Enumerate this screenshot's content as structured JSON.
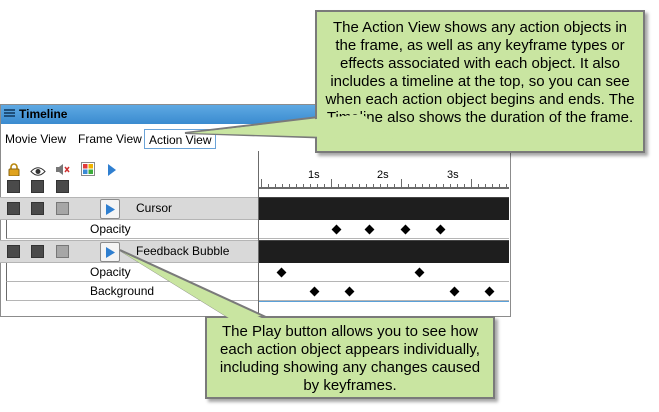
{
  "window": {
    "title": "Timeline",
    "tabs": [
      {
        "label": "Movie View",
        "active": false
      },
      {
        "label": "Frame View",
        "active": false
      },
      {
        "label": "Action View",
        "active": true
      }
    ]
  },
  "ruler": {
    "labels": [
      "1s",
      "2s",
      "3s"
    ]
  },
  "rows": [
    {
      "type": "object",
      "label": "Cursor"
    },
    {
      "type": "prop",
      "label": "Opacity"
    },
    {
      "type": "object",
      "label": "Feedback Bubble"
    },
    {
      "type": "prop",
      "label": "Opacity"
    },
    {
      "type": "prop",
      "label": "Background"
    }
  ],
  "callouts": {
    "action_view": "The Action View shows any action objects in the frame, as well as any keyframe types or effects associated with each object. It also includes a timeline at the top, so you can see when each action object begins and ends. The Timeline also shows the duration of the frame.",
    "play_button": "The Play button allows you to see how each action object appears individually, including showing any changes caused by keyframes."
  },
  "colors": {
    "callout_fill": "#c9e5a1",
    "titlebar": "#4a9ad9",
    "track_dark": "#1e1e1e"
  }
}
